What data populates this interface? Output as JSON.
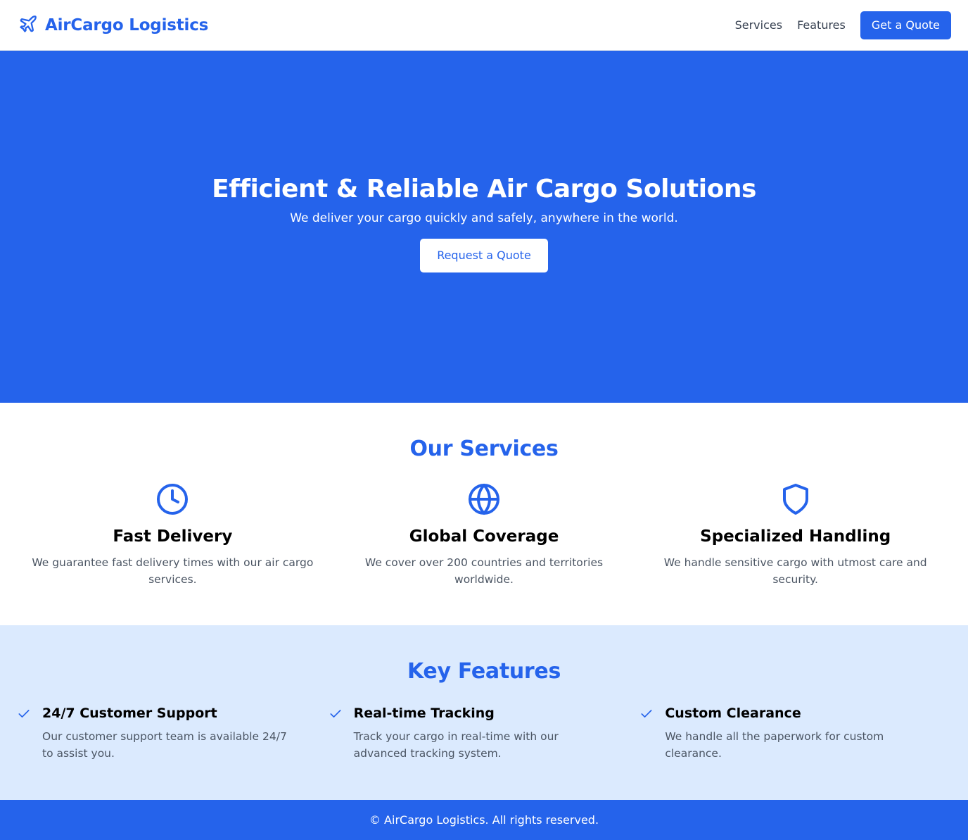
{
  "brand": {
    "name": "AirCargo Logistics",
    "icon": "airplane-icon",
    "color": "#2563eb"
  },
  "nav": {
    "links": [
      "Services",
      "Features"
    ],
    "cta": "Get a Quote"
  },
  "hero": {
    "title": "Efficient & Reliable Air Cargo Solutions",
    "subtitle": "We deliver your cargo quickly and safely, anywhere in the world.",
    "button": "Request a Quote",
    "background": "#2563eb"
  },
  "services": {
    "title": "Our Services",
    "items": [
      {
        "icon": "clock-icon",
        "title": "Fast Delivery",
        "desc": "We guarantee fast delivery times with our air cargo services."
      },
      {
        "icon": "globe-icon",
        "title": "Global Coverage",
        "desc": "We cover over 200 countries and territories worldwide."
      },
      {
        "icon": "shield-icon",
        "title": "Specialized Handling",
        "desc": "We handle sensitive cargo with utmost care and security."
      }
    ]
  },
  "features": {
    "title": "Key Features",
    "background": "#dbeafe",
    "items": [
      {
        "icon": "check-icon",
        "title": "24/7 Customer Support",
        "desc": "Our customer support team is available 24/7 to assist you."
      },
      {
        "icon": "check-icon",
        "title": "Real-time Tracking",
        "desc": "Track your cargo in real-time with our advanced tracking system."
      },
      {
        "icon": "check-icon",
        "title": "Custom Clearance",
        "desc": "We handle all the paperwork for custom clearance."
      }
    ]
  },
  "footer": {
    "text": "© AirCargo Logistics. All rights reserved."
  }
}
